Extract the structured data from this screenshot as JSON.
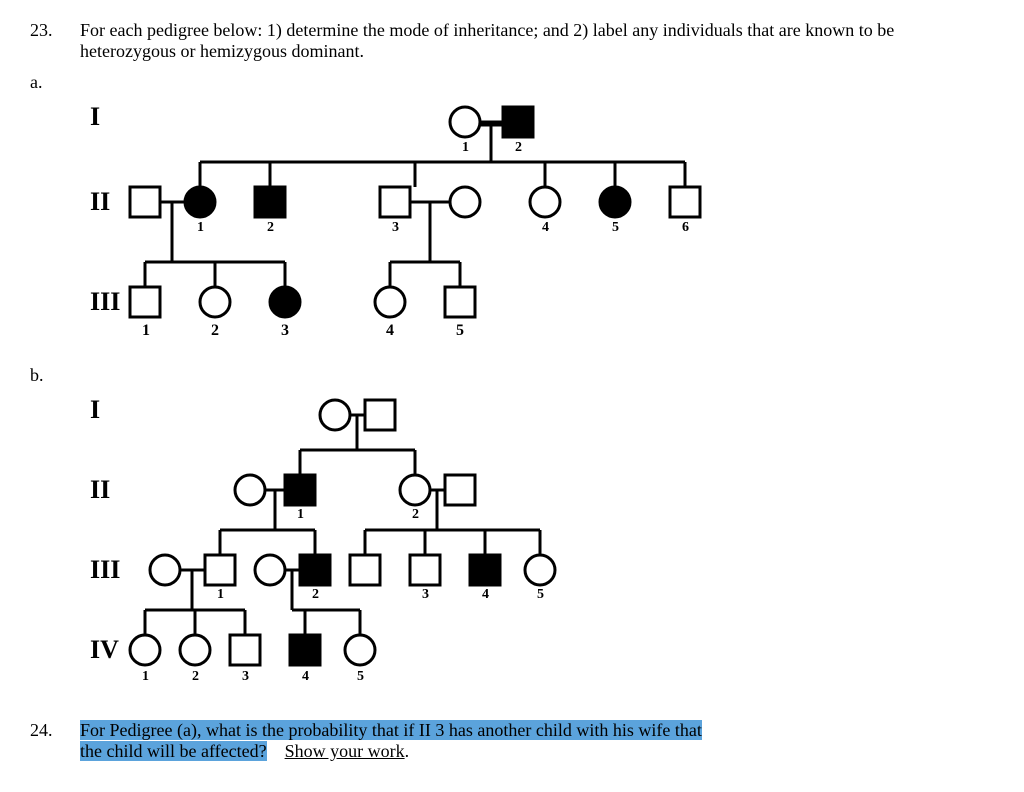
{
  "q23": {
    "num": "23.",
    "text": "For each pedigree below:  1) determine the mode of inheritance; and 2) label any individuals that are known to be heterozygous or hemizygous dominant."
  },
  "sub_a": "a.",
  "sub_b": "b.",
  "gen": {
    "I": "I",
    "II": "II",
    "III": "III",
    "IV": "IV"
  },
  "pedigree_a": {
    "gen1": {
      "n1": "1",
      "n2": "2"
    },
    "gen2": {
      "n1": "1",
      "n2": "2",
      "n3": "3",
      "n4": "4",
      "n5": "5",
      "n6": "6"
    },
    "gen3": {
      "n1": "1",
      "n2": "2",
      "n3": "3",
      "n4": "4",
      "n5": "5"
    }
  },
  "pedigree_b": {
    "gen2": {
      "n1": "1",
      "n2": "2"
    },
    "gen3": {
      "n1": "1",
      "n2": "2",
      "n3": "3",
      "n4": "4",
      "n5": "5"
    },
    "gen4": {
      "n1": "1",
      "n2": "2",
      "n3": "3",
      "n4": "4",
      "n5": "5"
    }
  },
  "q24": {
    "num": "24.",
    "text_part1": "For Pedigree (a), what is the probability that if II 3 has another child with his wife that ",
    "text_part2": "the child will be affected?",
    "text_show": "Show your work",
    "period": "."
  }
}
